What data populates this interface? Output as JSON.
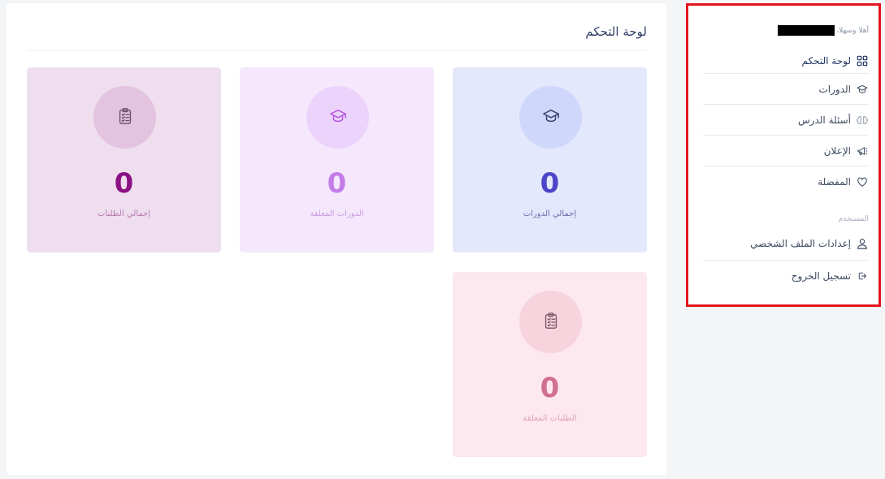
{
  "main": {
    "title": "لوحة التحكم",
    "cards": {
      "courses": {
        "value": "0",
        "label": "إجمالي الدورات",
        "icon": "graduation-cap-icon"
      },
      "pending_courses": {
        "value": "0",
        "label": "الدورات المعلقة",
        "icon": "graduation-cap-icon"
      },
      "requests": {
        "value": "0",
        "label": "إجمالي الطلبات",
        "icon": "clipboard-icon"
      },
      "pending_requests": {
        "value": "0",
        "label": "الطلبات المعلقة",
        "icon": "clipboard-icon"
      }
    }
  },
  "sidebar": {
    "welcome": "أهلا وسهلا،",
    "items": [
      {
        "label": "لوحة التحكم",
        "icon": "grid-icon"
      },
      {
        "label": "الدورات",
        "icon": "graduation-cap-icon"
      },
      {
        "label": "أسئلة الدرس",
        "icon": "brain-icon"
      },
      {
        "label": "الإعلان",
        "icon": "megaphone-icon"
      },
      {
        "label": "المفضلة",
        "icon": "heart-icon"
      }
    ],
    "section_label": "المستخدم",
    "user_items": [
      {
        "label": "إعدادات الملف الشخصي",
        "icon": "user-icon"
      },
      {
        "label": "تسجيل الخروج",
        "icon": "logout-icon"
      }
    ]
  },
  "colors": {
    "highlight_border": "#e3141d",
    "courses_accent": "#4d45c7",
    "pending_courses_accent": "#c47de8",
    "requests_accent": "#8a1282",
    "pending_requests_accent": "#d0708e"
  }
}
